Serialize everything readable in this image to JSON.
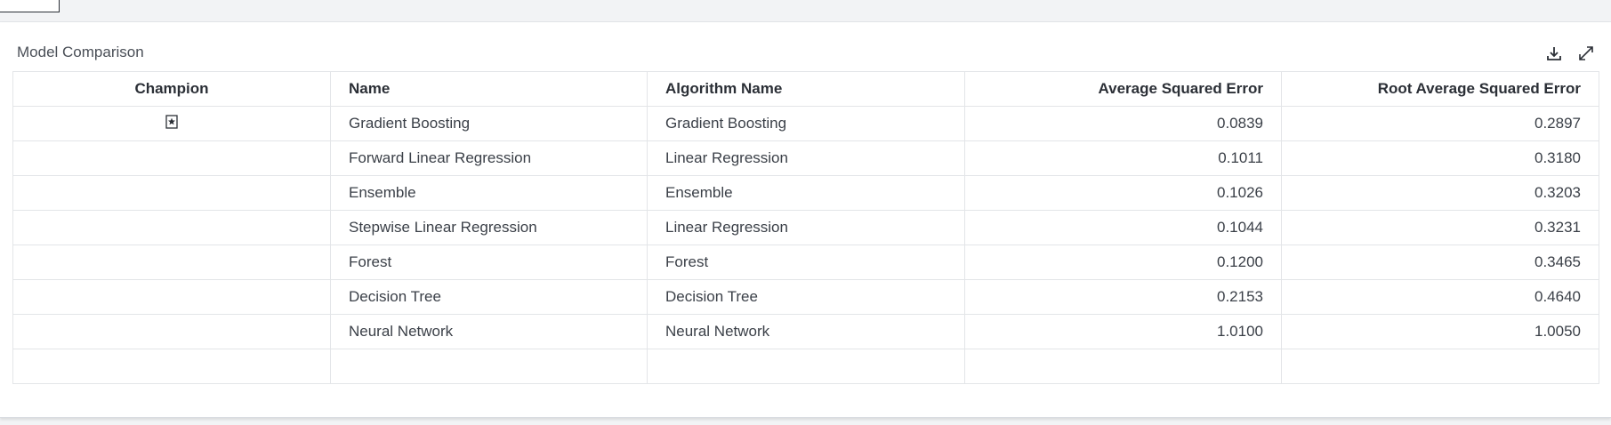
{
  "panel": {
    "title": "Model Comparison",
    "icons": [
      "download-icon",
      "expand-icon"
    ]
  },
  "table": {
    "columns": [
      "Champion",
      "Name",
      "Algorithm Name",
      "Average Squared Error",
      "Root Average Squared Error"
    ],
    "rows": [
      {
        "champion_icon": "bookmark-star-icon",
        "name": "Gradient Boosting",
        "algorithm": "Gradient Boosting",
        "ase": "0.0839",
        "rase": "0.2897"
      },
      {
        "champion_icon": "",
        "name": "Forward Linear Regression",
        "algorithm": "Linear Regression",
        "ase": "0.1011",
        "rase": "0.3180"
      },
      {
        "champion_icon": "",
        "name": "Ensemble",
        "algorithm": "Ensemble",
        "ase": "0.1026",
        "rase": "0.3203"
      },
      {
        "champion_icon": "",
        "name": "Stepwise Linear Regression",
        "algorithm": "Linear Regression",
        "ase": "0.1044",
        "rase": "0.3231"
      },
      {
        "champion_icon": "",
        "name": "Forest",
        "algorithm": "Forest",
        "ase": "0.1200",
        "rase": "0.3465"
      },
      {
        "champion_icon": "",
        "name": "Decision Tree",
        "algorithm": "Decision Tree",
        "ase": "0.2153",
        "rase": "0.4640"
      },
      {
        "champion_icon": "",
        "name": "Neural Network",
        "algorithm": "Neural Network",
        "ase": "1.0100",
        "rase": "1.0050"
      }
    ]
  },
  "colors": {
    "text": "#2b2f36",
    "grid_line": "#e3e5e8",
    "page_bg": "#f2f3f5"
  }
}
